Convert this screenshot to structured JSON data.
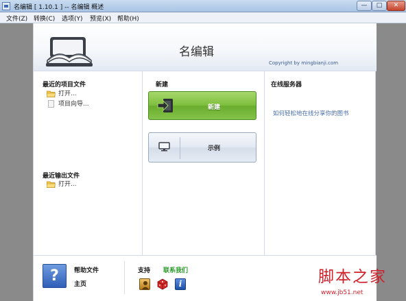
{
  "window": {
    "title": "名编辑 [ 1.10.1 ] -- 名编辑 概述",
    "minimize": "—",
    "maximize": "□",
    "close": "✕"
  },
  "menu": [
    "文件(Z)",
    "转换(C)",
    "选项(Y)",
    "预览(X)",
    "帮助(H)"
  ],
  "header": {
    "app_name": "名编辑",
    "copyright": "Copyright by mingbianji.com"
  },
  "recent_projects": {
    "title": "最近的项目文件",
    "items": [
      {
        "label": "打开...",
        "icon": "folder-icon"
      },
      {
        "label": "项目向导...",
        "icon": "document-icon"
      }
    ]
  },
  "recent_outputs": {
    "title": "最近输出文件",
    "items": [
      {
        "label": "打开...",
        "icon": "folder-icon"
      }
    ]
  },
  "new_section": {
    "title": "新建",
    "new_button": "新建",
    "example_button": "示例"
  },
  "server": {
    "title": "在线服务器",
    "link": "如何轻松地在线分享你的图书"
  },
  "footer": {
    "help_icon": "?",
    "help_file": "帮助文件",
    "home": "主页",
    "support": "支持",
    "contact": "联系我们",
    "info_icon": "i"
  },
  "watermark": {
    "main": "脚本之家",
    "url": "www.jb51.net"
  },
  "colors": {
    "accent_green": "#7fbf3f",
    "link_blue": "#4a6ea8",
    "contact_green": "#2a9a2a",
    "watermark_red": "#d0202a"
  }
}
